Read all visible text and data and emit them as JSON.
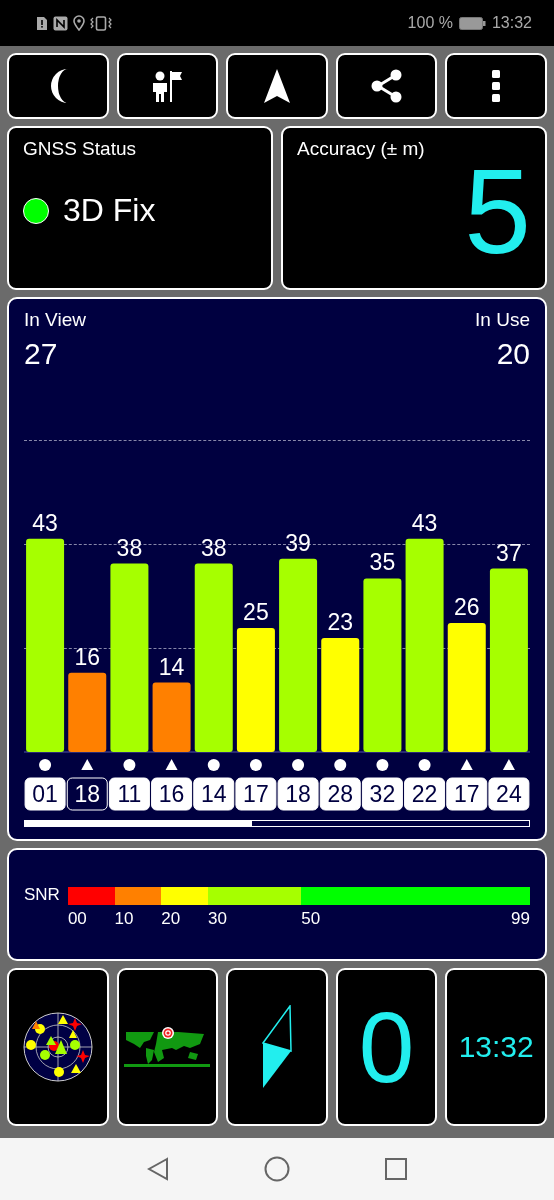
{
  "status_bar": {
    "battery": "100 %",
    "time": "13:32"
  },
  "gnss_status": {
    "title": "GNSS Status",
    "fix": "3D Fix",
    "color": "#00ff00"
  },
  "accuracy": {
    "title": "Accuracy (± m)",
    "value": "5"
  },
  "satellites_panel": {
    "in_view_label": "In View",
    "in_view": "27",
    "in_use_label": "In Use",
    "in_use": "20",
    "chart_data": {
      "type": "bar",
      "categories": [
        "01",
        "18",
        "11",
        "16",
        "14",
        "17",
        "18",
        "28",
        "32",
        "22",
        "17",
        "24"
      ],
      "values": [
        43,
        16,
        38,
        14,
        38,
        25,
        39,
        23,
        35,
        43,
        26,
        37
      ],
      "data_labels": true
    },
    "satellites": [
      {
        "kind": "circle",
        "selected": false
      },
      {
        "kind": "triangle",
        "selected": true
      },
      {
        "kind": "circle",
        "selected": false
      },
      {
        "kind": "triangle",
        "selected": false
      },
      {
        "kind": "circle",
        "selected": false
      },
      {
        "kind": "circle",
        "selected": false
      },
      {
        "kind": "circle",
        "selected": false
      },
      {
        "kind": "circle",
        "selected": false
      },
      {
        "kind": "circle",
        "selected": false
      },
      {
        "kind": "circle",
        "selected": false
      },
      {
        "kind": "triangle",
        "selected": false
      },
      {
        "kind": "triangle",
        "selected": false
      }
    ]
  },
  "snr": {
    "label": "SNR",
    "max_label": "99",
    "segments": [
      {
        "from": "00",
        "color": "#ff0000"
      },
      {
        "from": "10",
        "color": "#ff8000"
      },
      {
        "from": "20",
        "color": "#ffff00"
      },
      {
        "from": "30",
        "color": "#a6ff00"
      },
      {
        "from": "50",
        "color": "#00ff00"
      }
    ]
  },
  "tiles": [
    {
      "kind": "skyplot"
    },
    {
      "kind": "map"
    },
    {
      "kind": "compass"
    },
    {
      "kind": "speed",
      "value": "0"
    },
    {
      "kind": "clock",
      "value": "13:32"
    }
  ]
}
